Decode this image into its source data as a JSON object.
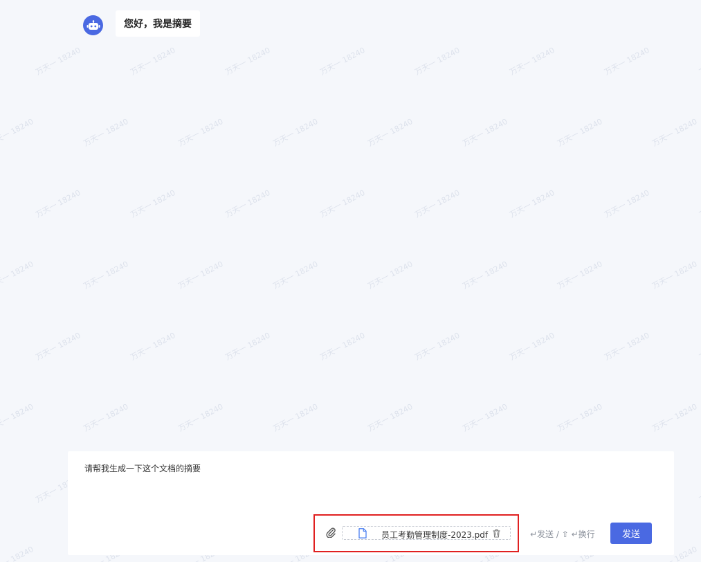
{
  "chat": {
    "greeting": "您好，我是摘要"
  },
  "composer": {
    "input_text": "请帮我生成一下这个文档的摘要",
    "attachment": {
      "file_name": "员工考勤管理制度-2023.pdf"
    },
    "shortcut_hint": "↵发送 / ⇧ ↵换行",
    "send_label": "发送"
  },
  "watermark": {
    "text": "万天一 18240"
  },
  "colors": {
    "accent": "#4a69e2",
    "highlight_border": "#e02020",
    "background": "#f5f7fb"
  },
  "icons": [
    "robot-icon",
    "paperclip-icon",
    "file-icon",
    "trash-icon"
  ]
}
